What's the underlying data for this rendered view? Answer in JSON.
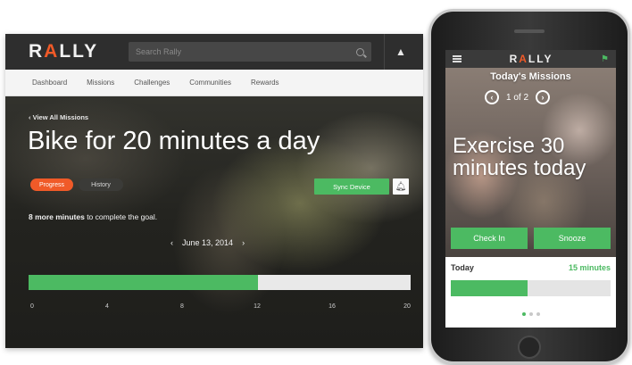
{
  "desktop": {
    "logo": {
      "prefix": "R",
      "accent": "A",
      "suffix": "LLY"
    },
    "search": {
      "placeholder": "Search Rally"
    },
    "nav": [
      "Dashboard",
      "Missions",
      "Challenges",
      "Communities",
      "Rewards"
    ],
    "back_link": "‹ View All Missions",
    "mission_title": "Bike for 20 minutes a day",
    "tabs": {
      "progress": "Progress",
      "history": "History"
    },
    "sync_button": "Sync Device",
    "goal": {
      "bold": "8 more minutes",
      "rest": " to complete the goal."
    },
    "date": {
      "prev": "‹",
      "label": "June 13, 2014",
      "next": "›"
    },
    "progress": {
      "value": 12,
      "max": 20,
      "fraction": 0.6
    },
    "ticks": [
      "0",
      "4",
      "8",
      "12",
      "16",
      "20"
    ]
  },
  "mobile": {
    "logo": {
      "prefix": "R",
      "accent": "A",
      "suffix": "LLY"
    },
    "heading": "Today's Missions",
    "pager": {
      "prev": "‹",
      "label": "1 of 2",
      "next": "›"
    },
    "mission_title": "Exercise 30 minutes today",
    "buttons": {
      "check_in": "Check In",
      "snooze": "Snooze"
    },
    "today_label": "Today",
    "minutes_label": "15 minutes",
    "progress": {
      "fraction": 0.48
    },
    "dots": 3,
    "active_dot": 0
  },
  "colors": {
    "accent_orange": "#f05a28",
    "accent_green": "#4cba62"
  },
  "icons": [
    "search-icon",
    "alert-icon",
    "bell-icon",
    "menu-icon",
    "flag-icon",
    "chevron-left-icon",
    "chevron-right-icon"
  ]
}
